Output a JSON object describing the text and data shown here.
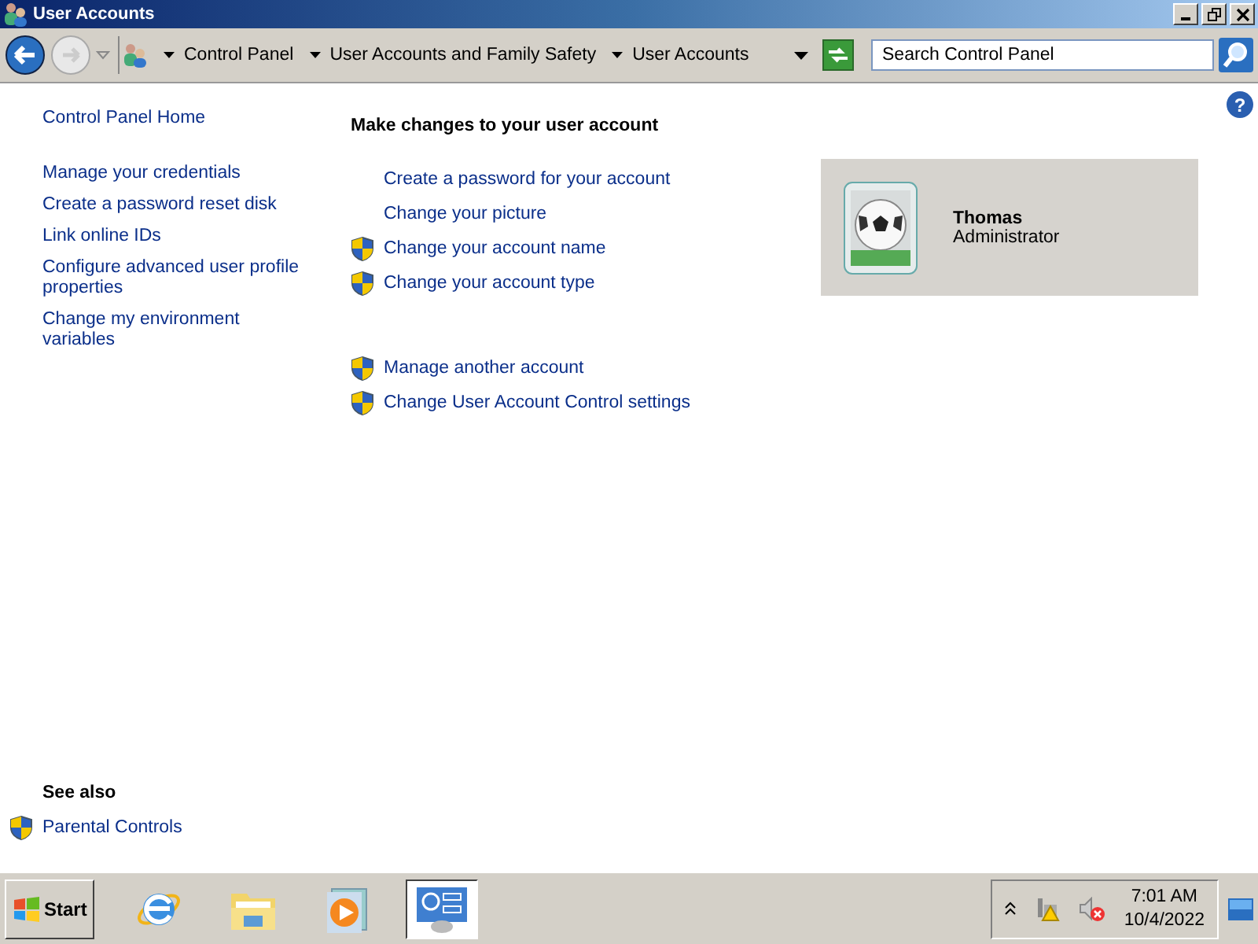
{
  "window": {
    "title": "User Accounts"
  },
  "address_bar": {
    "breadcrumbs": [
      "Control Panel",
      "User Accounts and Family Safety",
      "User Accounts"
    ]
  },
  "search": {
    "placeholder": "Search Control Panel"
  },
  "help_button": "?",
  "sidebar": {
    "home": "Control Panel Home",
    "items": [
      "Manage your credentials",
      "Create a password reset disk",
      "Link online IDs",
      "Configure advanced user profile properties",
      "Change my environment variables"
    ],
    "see_also": {
      "title": "See also",
      "items": [
        {
          "label": "Parental Controls",
          "shield": true
        }
      ]
    }
  },
  "main": {
    "heading": "Make changes to your user account",
    "groups": [
      {
        "links": [
          {
            "label": "Create a password for your account",
            "shield": false
          },
          {
            "label": "Change your picture",
            "shield": false
          },
          {
            "label": "Change your account name",
            "shield": true
          },
          {
            "label": "Change your account type",
            "shield": true
          }
        ]
      },
      {
        "links": [
          {
            "label": "Manage another account",
            "shield": true
          },
          {
            "label": "Change User Account Control settings",
            "shield": true
          }
        ]
      }
    ]
  },
  "account": {
    "name": "Thomas",
    "role": "Administrator"
  },
  "taskbar": {
    "start": "Start",
    "apps": [
      {
        "kind": "browser",
        "selected": false
      },
      {
        "kind": "folder",
        "selected": false
      },
      {
        "kind": "media",
        "selected": false
      },
      {
        "kind": "control-panel",
        "selected": true
      }
    ],
    "tray": {
      "time": "7:01 AM",
      "date": "10/4/2022"
    }
  }
}
